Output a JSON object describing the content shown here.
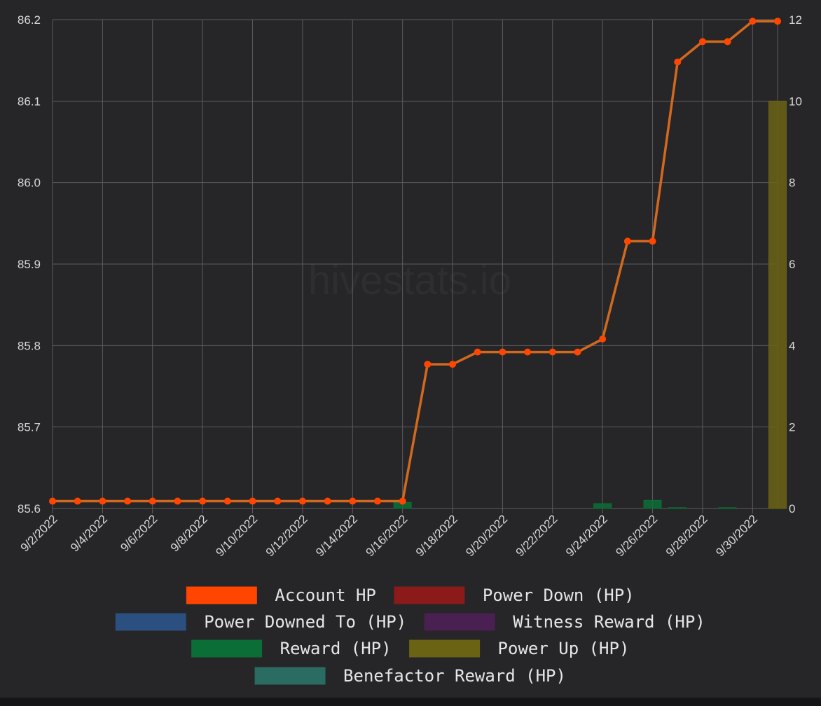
{
  "watermark": "hivestats.io",
  "colors": {
    "background": "#262628",
    "grid": "#5c5c60",
    "tick_text": "#d8d8d8",
    "legend_text": "#e6e6e6"
  },
  "chart_data": {
    "type": "line",
    "x": [
      "9/2/2022",
      "9/3/2022",
      "9/4/2022",
      "9/5/2022",
      "9/6/2022",
      "9/7/2022",
      "9/8/2022",
      "9/9/2022",
      "9/10/2022",
      "9/11/2022",
      "9/12/2022",
      "9/13/2022",
      "9/14/2022",
      "9/15/2022",
      "9/16/2022",
      "9/17/2022",
      "9/18/2022",
      "9/19/2022",
      "9/20/2022",
      "9/21/2022",
      "9/22/2022",
      "9/23/2022",
      "9/24/2022",
      "9/25/2022",
      "9/26/2022",
      "9/27/2022",
      "9/28/2022",
      "9/29/2022",
      "9/30/2022",
      "10/1/2022"
    ],
    "x_tick_labels": [
      "9/2/2022",
      "9/4/2022",
      "9/6/2022",
      "9/8/2022",
      "9/10/2022",
      "9/12/2022",
      "9/14/2022",
      "9/16/2022",
      "9/18/2022",
      "9/20/2022",
      "9/22/2022",
      "9/24/2022",
      "9/26/2022",
      "9/28/2022",
      "9/30/2022"
    ],
    "y_left": {
      "ylim": [
        85.6,
        86.2
      ],
      "ticks": [
        "86.2",
        "86.1",
        "86.0",
        "85.9",
        "85.8",
        "85.7",
        "85.6"
      ]
    },
    "y_right": {
      "ylim": [
        0,
        12
      ],
      "ticks": [
        "12",
        "10",
        "8",
        "6",
        "4",
        "2",
        "0"
      ]
    },
    "grid": true,
    "legend_position": "bottom",
    "series": [
      {
        "name": "Account HP",
        "type": "line",
        "axis": "left",
        "color": "#ff4500",
        "line_color": "#d2691e",
        "values": [
          85.609,
          85.609,
          85.609,
          85.609,
          85.609,
          85.609,
          85.609,
          85.609,
          85.609,
          85.609,
          85.609,
          85.609,
          85.609,
          85.609,
          85.609,
          85.777,
          85.777,
          85.792,
          85.792,
          85.792,
          85.792,
          85.792,
          85.808,
          85.928,
          85.928,
          86.148,
          86.173,
          86.173,
          86.198,
          86.198
        ]
      },
      {
        "name": "Power Down (HP)",
        "type": "bar",
        "axis": "right",
        "color": "#8b1a1a",
        "values": []
      },
      {
        "name": "Power Downed To (HP)",
        "type": "bar",
        "axis": "right",
        "color": "#2b4f7e",
        "values": []
      },
      {
        "name": "Witness Reward (HP)",
        "type": "bar",
        "axis": "right",
        "color": "#4a1f52",
        "values": []
      },
      {
        "name": "Reward (HP)",
        "type": "bar",
        "axis": "right",
        "color": "#0c6e37",
        "values": [
          0,
          0,
          0,
          0,
          0,
          0,
          0,
          0,
          0,
          0,
          0,
          0,
          0,
          0,
          0.15,
          0,
          0,
          0,
          0,
          0,
          0,
          0,
          0.12,
          0,
          0.2,
          0.02,
          0,
          0.02,
          0,
          0
        ]
      },
      {
        "name": "Power Up (HP)",
        "type": "bar",
        "axis": "right",
        "color": "#6b6314",
        "values": [
          0,
          0,
          0,
          0,
          0,
          0,
          0,
          0,
          0,
          0,
          0,
          0,
          0,
          0,
          0,
          0,
          0,
          0,
          0,
          0,
          0,
          0,
          0,
          0,
          0,
          0,
          0,
          0,
          0,
          10
        ]
      },
      {
        "name": "Benefactor Reward (HP)",
        "type": "bar",
        "axis": "right",
        "color": "#2a6b62",
        "values": []
      }
    ]
  }
}
